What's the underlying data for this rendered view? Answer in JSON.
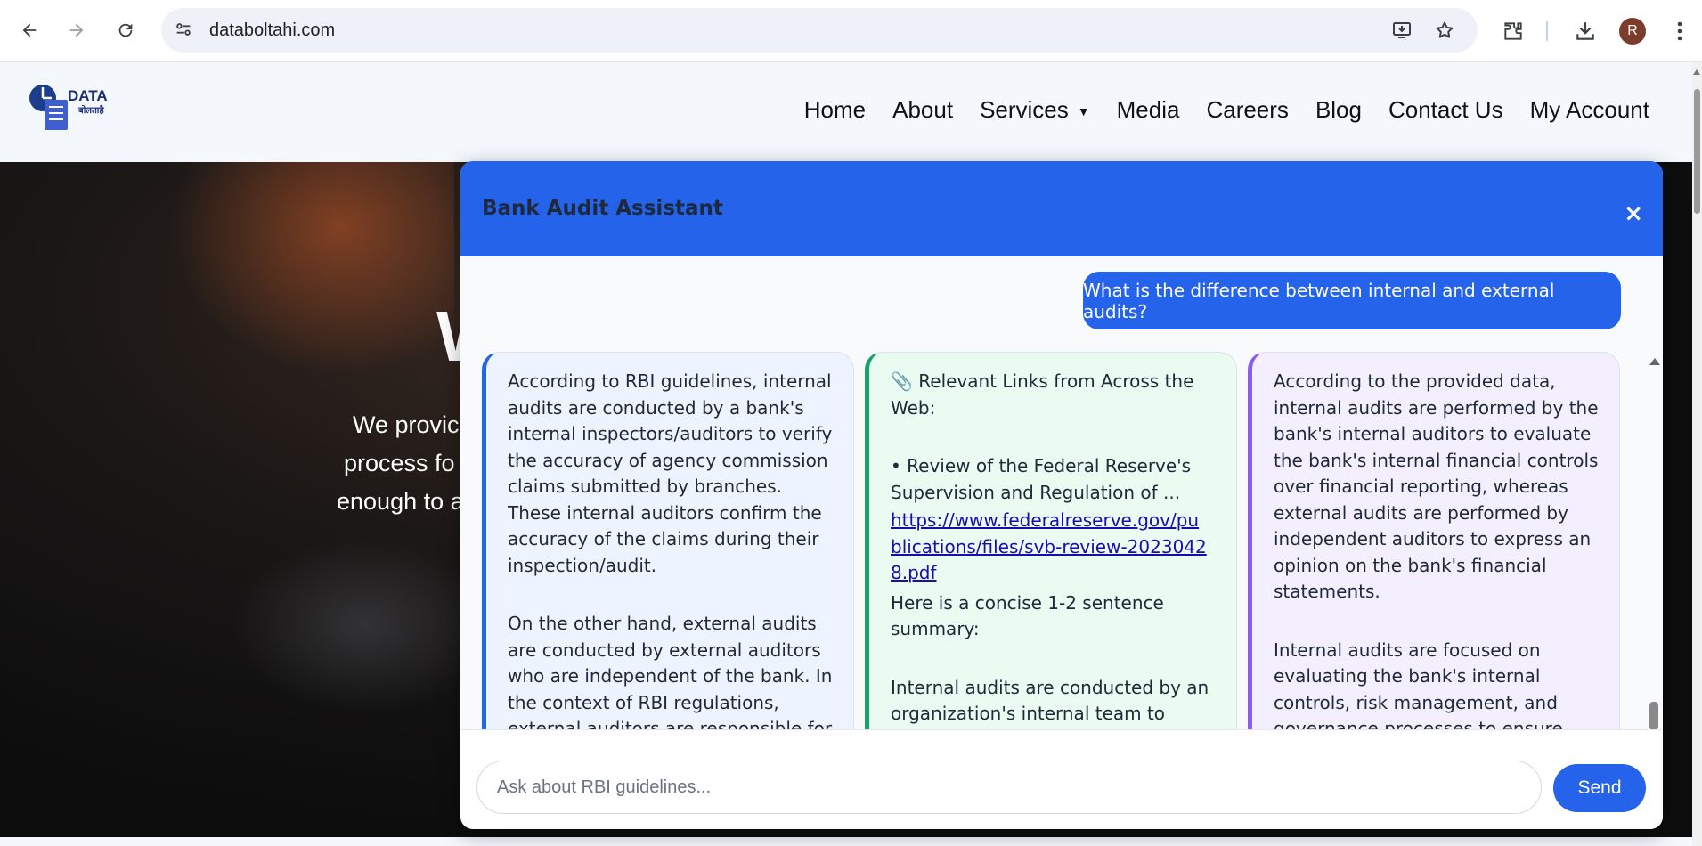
{
  "browser": {
    "url": "databoltahi.com",
    "avatar_letter": "R",
    "icons": [
      "back-arrow-icon",
      "forward-arrow-icon",
      "reload-icon",
      "site-info-icon",
      "install-app-icon",
      "bookmark-star-icon",
      "extensions-icon",
      "download-icon",
      "kebab-menu-icon"
    ]
  },
  "site": {
    "logo_text": "DATA",
    "logo_sub": "बोलताहै",
    "nav": [
      "Home",
      "About",
      "Services",
      "Media",
      "Careers",
      "Blog",
      "Contact Us",
      "My Account"
    ],
    "services_caret": "▼"
  },
  "hero": {
    "title_fragment": "W",
    "lines": [
      "We provic",
      "process fo",
      "enough to a"
    ]
  },
  "chat": {
    "title": "Bank Audit Assistant",
    "close_label": "×",
    "user_message": "What is the difference between internal and external audits?",
    "cards": [
      {
        "paragraphs": [
          "According to RBI guidelines, internal audits are conducted by a bank's internal inspectors/auditors to verify the accuracy of agency commission claims submitted by branches. These internal auditors confirm the accuracy of the claims during their inspection/audit.",
          "On the other hand, external audits are conducted by external auditors who are independent of the bank. In the context of RBI regulations, external auditors are responsible for auditing a"
        ]
      },
      {
        "heading_icon": "📎",
        "heading": "Relevant Links from Across the Web:",
        "item": "• Review of the Federal Reserve's Supervision and Regulation of ...",
        "link": "https://www.federalreserve.gov/publications/files/svb-review-20230428.pdf",
        "summary_intro": "Here is a concise 1-2 sentence summary:",
        "summary": "Internal audits are conducted by an organization's internal team to evaluate and improve its own"
      },
      {
        "paragraphs": [
          "According to the provided data, internal audits are performed by the bank's internal auditors to evaluate the bank's internal financial controls over financial reporting, whereas external audits are performed by independent auditors to express an opinion on the bank's financial statements.",
          "Internal audits are focused on evaluating the bank's internal controls, risk management, and governance processes to ensure they are adequate and effective. The internal auditors"
        ]
      }
    ],
    "input_placeholder": "Ask about RBI guidelines...",
    "send_label": "Send",
    "accent_color": "#2563eb",
    "card_colors": [
      "#2563eb",
      "#16a36a",
      "#8b5cf6"
    ]
  }
}
